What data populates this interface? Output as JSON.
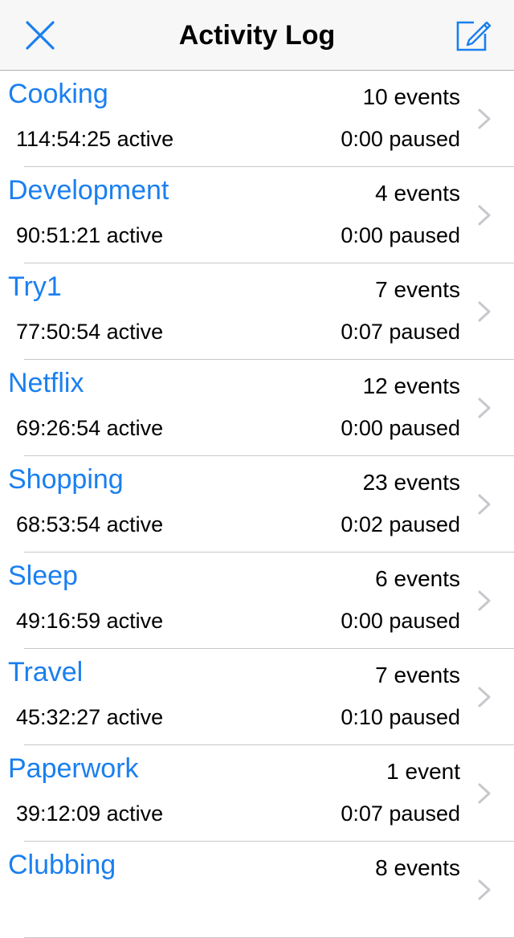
{
  "navbar": {
    "title": "Activity Log",
    "close_icon": "close-icon",
    "compose_icon": "compose-icon",
    "accent_color": "#1a7ff0"
  },
  "rows": [
    {
      "name": "Cooking",
      "events": "10 events",
      "active": "114:54:25 active",
      "paused": "0:00 paused"
    },
    {
      "name": "Development",
      "events": "4 events",
      "active": "90:51:21 active",
      "paused": "0:00 paused"
    },
    {
      "name": "Try1",
      "events": "7 events",
      "active": "77:50:54 active",
      "paused": "0:07 paused"
    },
    {
      "name": "Netflix",
      "events": "12 events",
      "active": "69:26:54 active",
      "paused": "0:00 paused"
    },
    {
      "name": "Shopping",
      "events": "23 events",
      "active": "68:53:54 active",
      "paused": "0:02 paused"
    },
    {
      "name": "Sleep",
      "events": "6 events",
      "active": "49:16:59 active",
      "paused": "0:00 paused"
    },
    {
      "name": "Travel",
      "events": "7 events",
      "active": "45:32:27 active",
      "paused": "0:10 paused"
    },
    {
      "name": "Paperwork",
      "events": "1 event",
      "active": "39:12:09 active",
      "paused": "0:07 paused"
    },
    {
      "name": "Clubbing",
      "events": "8 events",
      "active": "",
      "paused": ""
    }
  ]
}
